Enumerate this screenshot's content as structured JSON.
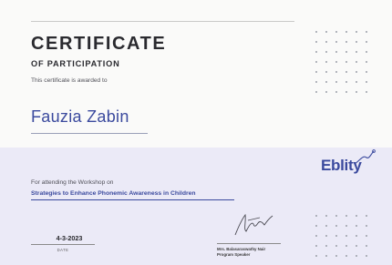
{
  "certificate": {
    "title": "CERTIFICATE",
    "subtitle": "OF PARTICIPATION",
    "awarded_text": "This certificate is awarded to",
    "recipient_name": "Fauzia Zabin",
    "attending_text": "For attending the Workshop on",
    "workshop_title": "Strategies to Enhance Phonemic Awareness in Children",
    "date_value": "4-3-2023",
    "date_label": "DATE",
    "signatory_name": "Mrs. Balasaraswathy Nair",
    "signatory_role": "Program Speaker",
    "logo_text": "Eblity"
  },
  "colors": {
    "accent": "#3b4a9e",
    "band": "#ebeaf7",
    "background": "#fafaf9",
    "text": "#2a2a2f"
  },
  "icons": {
    "logo_mark": "eblity-swoosh-icon",
    "signature": "handwritten-signature",
    "decor": "dot-grid"
  }
}
